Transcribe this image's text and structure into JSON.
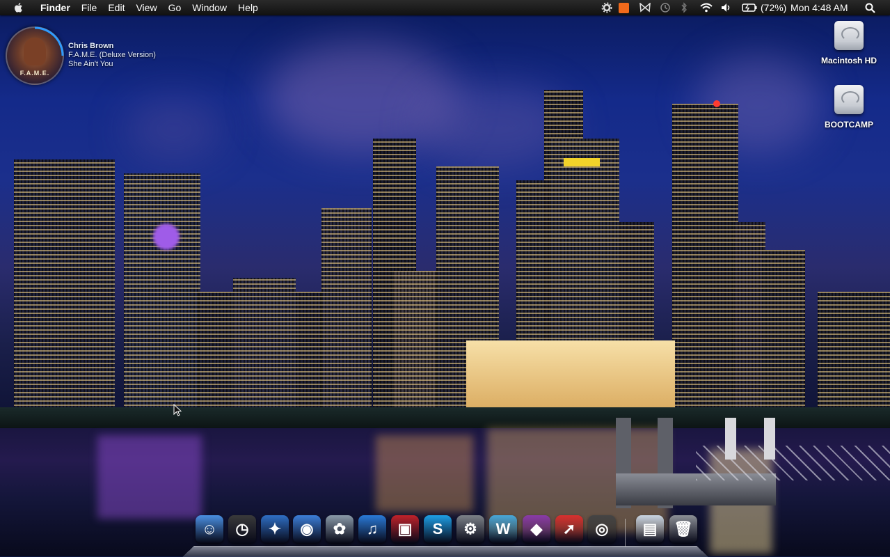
{
  "menubar": {
    "apple_icon": "apple-icon",
    "items": [
      {
        "label": "Finder",
        "bold": true
      },
      {
        "label": "File"
      },
      {
        "label": "Edit"
      },
      {
        "label": "View"
      },
      {
        "label": "Go"
      },
      {
        "label": "Window"
      },
      {
        "label": "Help"
      }
    ],
    "status": {
      "battery_percent": "(72%)",
      "clock": "Mon 4:48 AM",
      "icons": [
        "gear-icon",
        "app-orange-icon",
        "butterfly-icon",
        "time-machine-icon",
        "bluetooth-icon",
        "wifi-icon",
        "volume-icon",
        "battery-icon",
        "spotlight-icon"
      ]
    }
  },
  "now_playing": {
    "artist": "Chris Brown",
    "album": "F.A.M.E. (Deluxe Version)",
    "track": "She Ain't You",
    "album_art_text": "F.A.M.E."
  },
  "desktop": {
    "drives": [
      {
        "label": "Macintosh HD"
      },
      {
        "label": "BOOTCAMP"
      }
    ]
  },
  "dock": {
    "items": [
      {
        "name": "finder-icon",
        "glyph": "☺",
        "color": "#4a8fe0"
      },
      {
        "name": "dashboard-icon",
        "glyph": "◷",
        "color": "#3a3a3a"
      },
      {
        "name": "safari-icon",
        "glyph": "✦",
        "color": "#2f6fc4"
      },
      {
        "name": "ichat-icon",
        "glyph": "◉",
        "color": "#3d7fd8"
      },
      {
        "name": "iphoto-icon",
        "glyph": "✿",
        "color": "#8a9aa8"
      },
      {
        "name": "itunes-icon",
        "glyph": "♫",
        "color": "#2a7ad6"
      },
      {
        "name": "photobooth-icon",
        "glyph": "▣",
        "color": "#c0222a"
      },
      {
        "name": "skype-icon",
        "glyph": "S",
        "color": "#1e9fe6"
      },
      {
        "name": "system-preferences-icon",
        "glyph": "⚙",
        "color": "#7d8288"
      },
      {
        "name": "word-icon",
        "glyph": "W",
        "color": "#48a7d8"
      },
      {
        "name": "purple-app-icon",
        "glyph": "◆",
        "color": "#8a3aa8"
      },
      {
        "name": "cursor-app-icon",
        "glyph": "➚",
        "color": "#d8302e"
      },
      {
        "name": "dvd-player-icon",
        "glyph": "◎",
        "color": "#444"
      },
      {
        "name": "preview-icon",
        "glyph": "▤",
        "color": "#c9d4e2"
      },
      {
        "name": "trash-icon",
        "glyph": "🗑",
        "color": "#8c9096"
      }
    ]
  }
}
